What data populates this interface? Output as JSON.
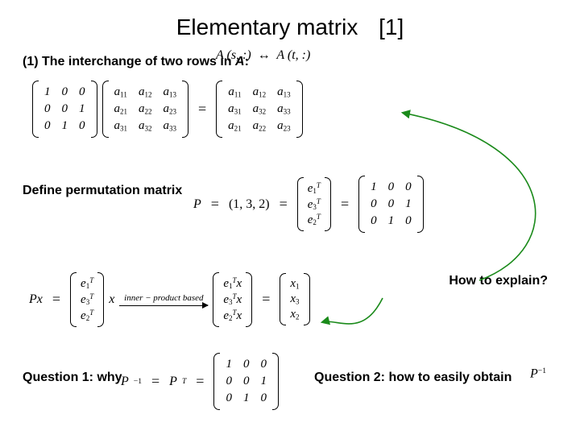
{
  "title": {
    "main": "Elementary matrix",
    "tag": "[1]"
  },
  "line1": {
    "prefix": "(1) The interchange of two rows in ",
    "A": "A",
    "suffix": ": "
  },
  "swap": {
    "lhs": "A (s, :)",
    "arrow": "↔",
    "rhs": "A (t, :)"
  },
  "bigeq": {
    "L1": [
      [
        "1",
        "0",
        "0"
      ],
      [
        "0",
        "0",
        "1"
      ],
      [
        "0",
        "1",
        "0"
      ]
    ],
    "L2": [
      [
        "a",
        "11",
        "a",
        "12",
        "a",
        "13"
      ],
      [
        "a",
        "21",
        "a",
        "22",
        "a",
        "23"
      ],
      [
        "a",
        "31",
        "a",
        "32",
        "a",
        "33"
      ]
    ],
    "eq": "=",
    "R": [
      [
        "a",
        "11",
        "a",
        "12",
        "a",
        "13"
      ],
      [
        "a",
        "31",
        "a",
        "32",
        "a",
        "33"
      ],
      [
        "a",
        "21",
        "a",
        "22",
        "a",
        "23"
      ]
    ]
  },
  "defperm": "Define permutation matrix",
  "Pdef": {
    "P": "P",
    "eq1": "=",
    "triple": "(1, 3, 2)",
    "eq2": "=",
    "evec": [
      "e",
      "1",
      "T",
      "e",
      "3",
      "T",
      "e",
      "2",
      "T"
    ],
    "eq3": "=",
    "I": [
      [
        "1",
        "0",
        "0"
      ],
      [
        "0",
        "0",
        "1"
      ],
      [
        "0",
        "1",
        "0"
      ]
    ]
  },
  "howto": "How to explain?",
  "Px": {
    "Px": "Px",
    "eq1": "=",
    "col": [
      "e",
      "1",
      "T",
      "e",
      "3",
      "T",
      "e",
      "2",
      "T"
    ],
    "x": "x",
    "arrowlabel": "inner − product  based",
    "mid": [
      "e",
      "1",
      "T",
      "x",
      "e",
      "3",
      "T",
      "x",
      "e",
      "2",
      "T",
      "x"
    ],
    "eq2": "=",
    "res": [
      "x",
      "1",
      "x",
      "3",
      "x",
      "2"
    ]
  },
  "q1": "Question 1: why",
  "Pinv": {
    "lhs": "P",
    "supm1": "−1",
    "eq1": "=",
    "PT": "P",
    "supT": "T",
    "eq2": "=",
    "I": [
      [
        "1",
        "0",
        "0"
      ],
      [
        "0",
        "0",
        "1"
      ],
      [
        "0",
        "1",
        "0"
      ]
    ]
  },
  "q2": "Question 2: how to easily obtain",
  "Pinv2": {
    "P": "P",
    "sup": "−1"
  }
}
